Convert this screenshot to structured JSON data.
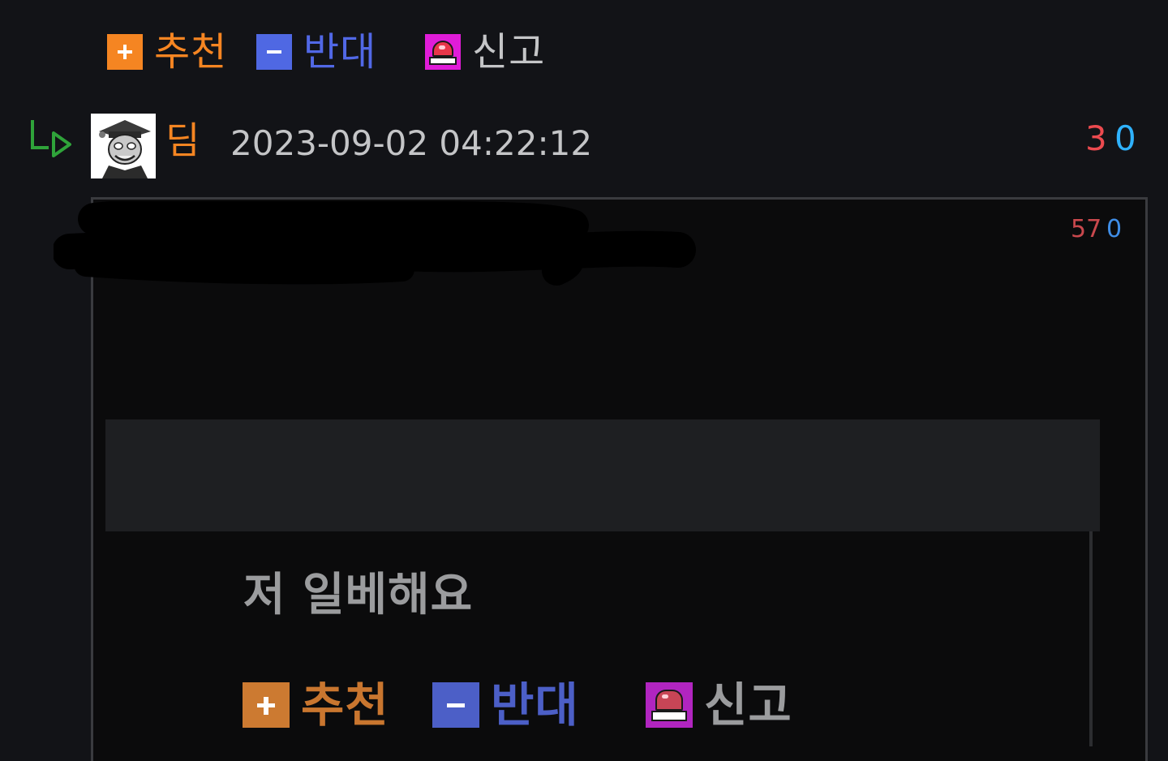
{
  "vote_bar": {
    "recommend_label": "추천",
    "oppose_label": "반대",
    "report_label": "신고"
  },
  "comment": {
    "author": "딤",
    "timestamp": "2023-09-02 04:22:12",
    "upvotes": "3",
    "downvotes": "0"
  },
  "embedded_image": {
    "upvotes": "57",
    "downvotes": "0",
    "text": "저 일베해요",
    "recommend_label": "추천",
    "oppose_label": "반대",
    "report_label": "신고"
  },
  "colors": {
    "recommend": "#f58522",
    "oppose": "#4f68e3",
    "report": "#e01cd8",
    "author": "#f58522",
    "upvote_count": "#ec4a4f",
    "downvote_count": "#2fb2ff"
  }
}
